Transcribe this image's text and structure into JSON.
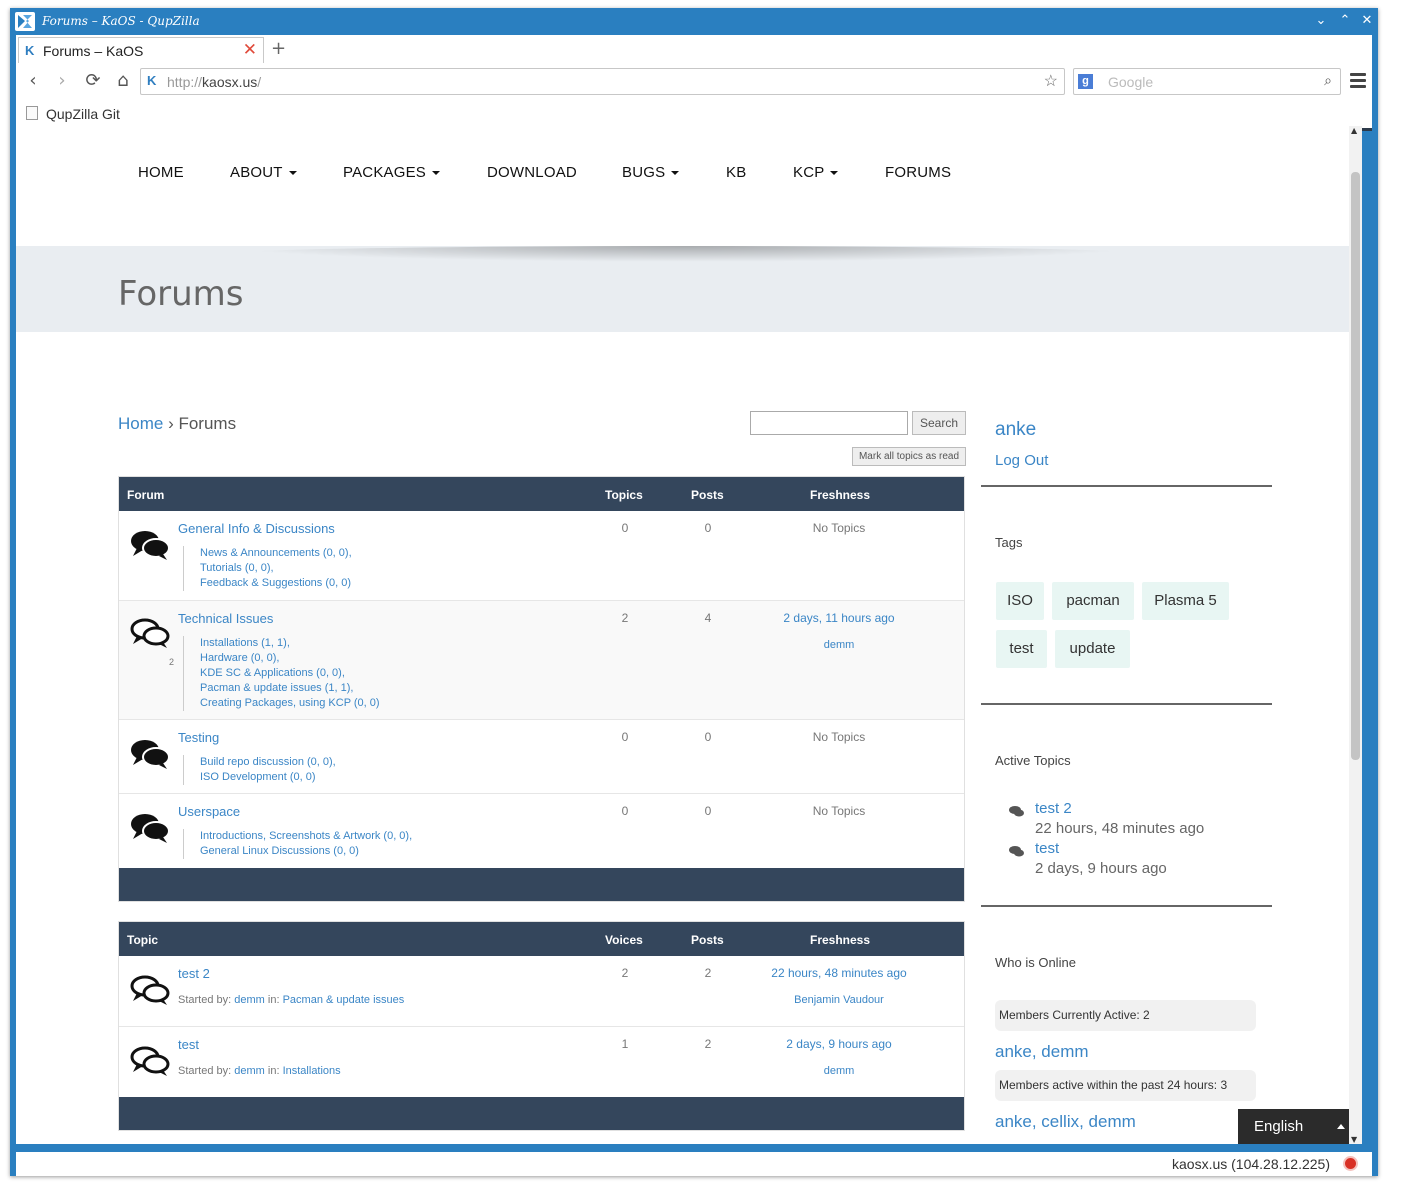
{
  "window": {
    "title": "Forums – KaOS - QupZilla"
  },
  "browser": {
    "tab_label": "Forums – KaOS",
    "url_prefix": "http://",
    "url_host": "kaosx.us",
    "url_rest": "/",
    "search_placeholder": "Google",
    "bookmark_label": "QupZilla Git",
    "status_text": "kaosx.us (104.28.12.225)"
  },
  "site": {
    "nav": [
      "HOME",
      "ABOUT",
      "PACKAGES",
      "DOWNLOAD",
      "BUGS",
      "KB",
      "KCP",
      "FORUMS"
    ],
    "hero_title": "Forums",
    "breadcrumb_home": "Home",
    "breadcrumb_sep": " › ",
    "breadcrumb_current": "Forums",
    "search_button": "Search",
    "mark_read_button": "Mark all topics as read"
  },
  "forums_table": {
    "headers": [
      "Forum",
      "Topics",
      "Posts",
      "Freshness"
    ],
    "rows": [
      {
        "title": "General Info & Discussions",
        "topics": "0",
        "posts": "0",
        "freshness": "No Topics",
        "by": "",
        "subforums": [
          "News & Announcements (0, 0),",
          "Tutorials (0, 0),",
          "Feedback & Suggestions (0, 0)"
        ]
      },
      {
        "title": "Technical Issues",
        "topics": "2",
        "posts": "4",
        "freshness": "2 days, 11 hours ago",
        "by": "demm",
        "topic_count": "2",
        "subforums": [
          "Installations (1, 1),",
          "Hardware (0, 0),",
          "KDE SC & Applications (0, 0),",
          "Pacman & update issues (1, 1),",
          "Creating Packages, using KCP (0, 0)"
        ]
      },
      {
        "title": "Testing",
        "topics": "0",
        "posts": "0",
        "freshness": "No Topics",
        "by": "",
        "subforums": [
          "Build repo discussion (0, 0),",
          "ISO Development (0, 0)"
        ]
      },
      {
        "title": "Userspace",
        "topics": "0",
        "posts": "0",
        "freshness": "No Topics",
        "by": "",
        "subforums": [
          "Introductions, Screenshots & Artwork (0, 0),",
          "General Linux Discussions (0, 0)"
        ]
      }
    ]
  },
  "topics_table": {
    "headers": [
      "Topic",
      "Voices",
      "Posts",
      "Freshness"
    ],
    "started_by": "Started by:",
    "in": "in:",
    "rows": [
      {
        "title": "test 2",
        "voices": "2",
        "posts": "2",
        "author": "demm",
        "forum": "Pacman & update issues",
        "freshness": "22 hours, 48 minutes ago",
        "by": "Benjamin Vaudour"
      },
      {
        "title": "test",
        "voices": "1",
        "posts": "2",
        "author": "demm",
        "forum": "Installations",
        "freshness": "2 days, 9 hours ago",
        "by": "demm"
      }
    ]
  },
  "sidebar": {
    "user": "anke",
    "logout": "Log Out",
    "tags_title": "Tags",
    "tags": [
      "ISO",
      "pacman",
      "Plasma 5",
      "test",
      "update"
    ],
    "active_title": "Active Topics",
    "active_topics": [
      {
        "title": "test 2",
        "time": "22 hours, 48 minutes ago"
      },
      {
        "title": "test",
        "time": "2 days, 9 hours ago"
      }
    ],
    "online_title": "Who is Online",
    "members_active_label": "Members Currently Active: 2",
    "members_active_users": "anke, demm",
    "members_24h_label": "Members active within the past 24 hours: 3",
    "members_24h_users": "anke, cellix, demm"
  },
  "language": "English"
}
